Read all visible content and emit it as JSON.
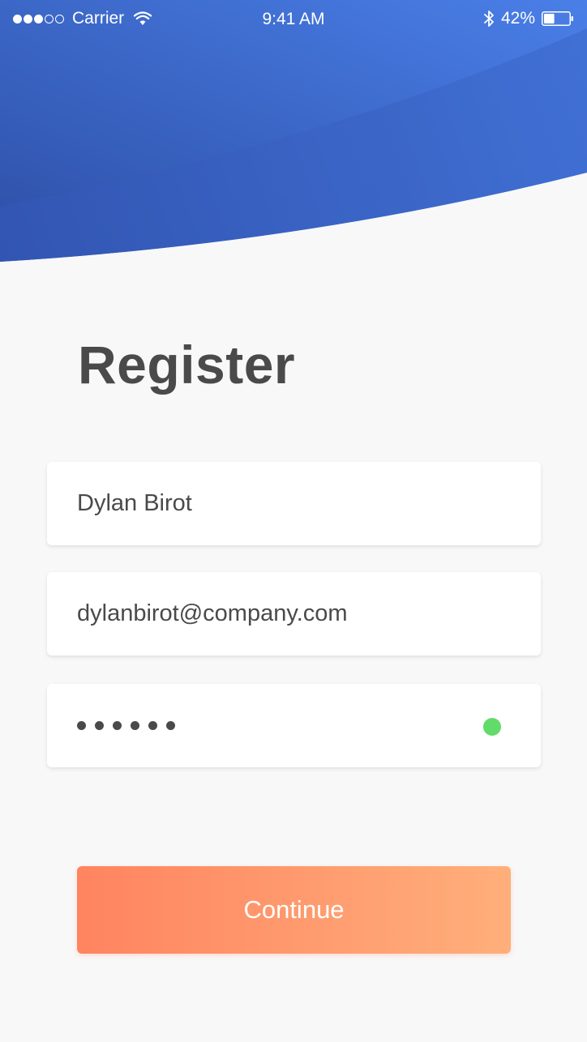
{
  "status_bar": {
    "carrier": "Carrier",
    "time": "9:41 AM",
    "battery": "42%",
    "battery_level": 0.42,
    "signal_strength": 3,
    "signal_total": 5
  },
  "title": "Register",
  "form": {
    "name": "Dylan Birot",
    "email": "dylanbirot@company.com",
    "password_length": 6,
    "password_valid": true
  },
  "actions": {
    "continue_label": "Continue"
  },
  "colors": {
    "header_gradient_start": "#2d4fa6",
    "header_gradient_end": "#4a7fe8",
    "accent_gradient_start": "#ff8460",
    "accent_gradient_end": "#ffaf7b",
    "valid_indicator": "#63db6a",
    "text": "#4a4a4a"
  },
  "icons": {
    "wifi": "wifi-icon",
    "bluetooth": "bluetooth-icon",
    "battery": "battery-icon"
  }
}
